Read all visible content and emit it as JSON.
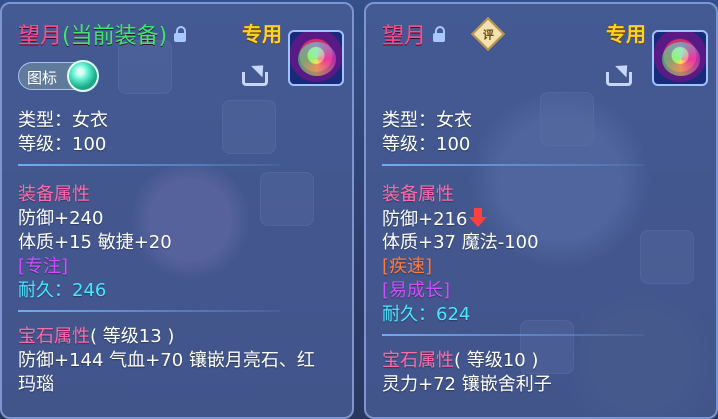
{
  "left": {
    "name": "望月",
    "name_suffix": "(当前装备)",
    "exclusive_label": "专用",
    "icon_toggle_label": "图标",
    "icon_toggle_on": true,
    "type_line": "类型：女衣",
    "level_line": "等级：100",
    "equip_attr_title": "装备属性",
    "stat_line1": "防御+240",
    "stat_line2": "体质+15 敏捷+20",
    "special_tag": "[专注]",
    "durability": "耐久：246",
    "gem_title": "宝石属性",
    "gem_level": "( 等级13 )",
    "gem_line1": "防御+144 气血+70 镶嵌月亮石、红",
    "gem_line2": "玛瑙"
  },
  "right": {
    "name": "望月",
    "rating_badge": "评",
    "exclusive_label": "专用",
    "type_line": "类型：女衣",
    "level_line": "等级：100",
    "equip_attr_title": "装备属性",
    "stat_line1": "防御+216",
    "stat_line2": "体质+37 魔法-100",
    "special_tag1": "[疾速]",
    "special_tag2": "[易成长]",
    "durability": "耐久：624",
    "gem_title": "宝石属性",
    "gem_level": "( 等级10 )",
    "gem_line1": "灵力+72 镶嵌舍利子"
  },
  "colors": {
    "title_pink": "#ff4d8a",
    "title_green": "#3ee66e",
    "exclusive_gold": "#ffd21e",
    "section_pink": "#ff6aa8",
    "cyan": "#48e6ff",
    "violet": "#d24cff",
    "orange": "#ff7a3c",
    "decrease_red": "#ff4040"
  }
}
